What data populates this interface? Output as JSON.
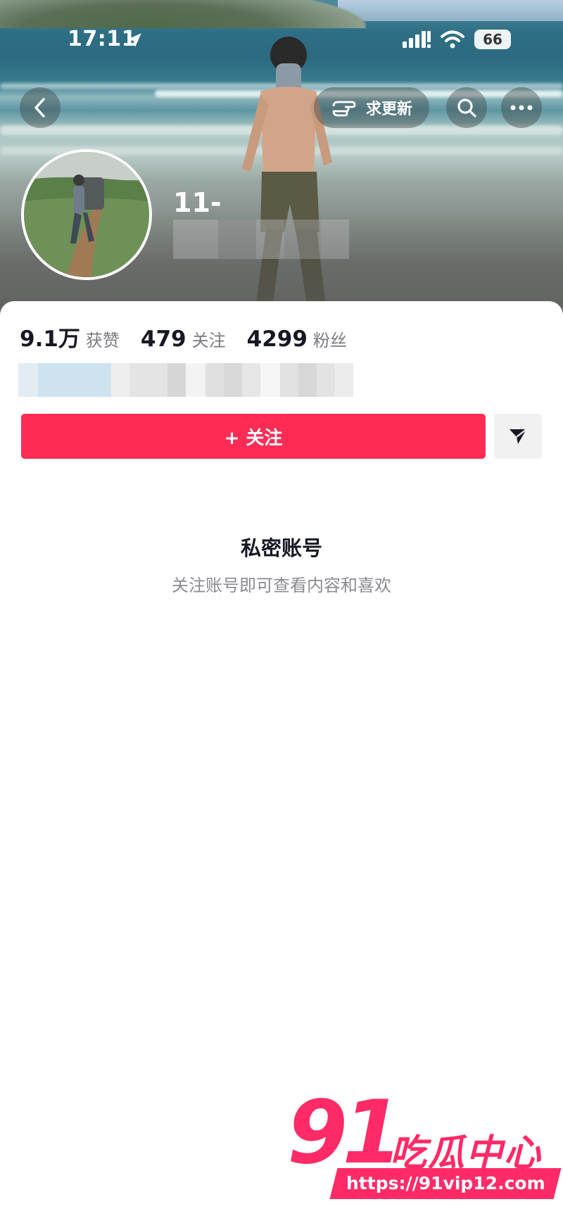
{
  "status_bar": {
    "time": "17:11",
    "battery": "66"
  },
  "top_nav": {
    "request_update_label": "求更新"
  },
  "profile": {
    "username": "11-",
    "stats": [
      {
        "value": "9.1万",
        "label": "获赞"
      },
      {
        "value": "479",
        "label": "关注"
      },
      {
        "value": "4299",
        "label": "粉丝"
      }
    ]
  },
  "actions": {
    "follow_label": "+ 关注"
  },
  "private_notice": {
    "title": "私密账号",
    "subtitle": "关注账号即可查看内容和喜欢"
  },
  "watermark": {
    "number": "91",
    "text": "吃瓜中心",
    "url": "https://91vip12.com"
  },
  "colors": {
    "follow_button": "#fe2c55",
    "watermark": "#ff2a66"
  }
}
